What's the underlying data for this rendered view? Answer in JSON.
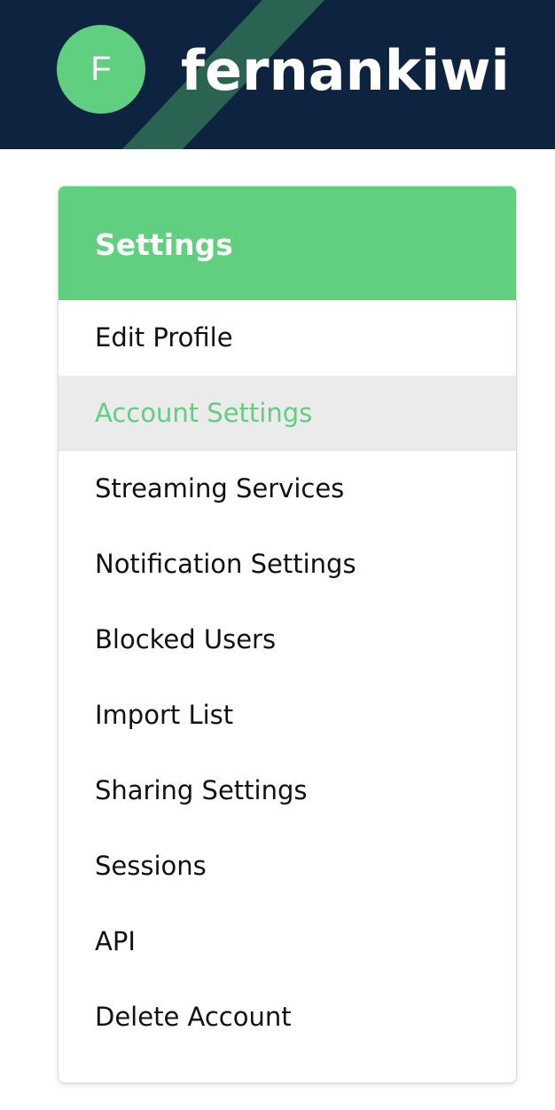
{
  "user": {
    "avatar_letter": "F",
    "username": "fernankiwi"
  },
  "colors": {
    "header_bg": "#0e2340",
    "accent": "#60cf80",
    "active_bg": "#ebebeb"
  },
  "settings": {
    "title": "Settings",
    "active_item": "Account Settings",
    "items": [
      {
        "label": "Edit Profile"
      },
      {
        "label": "Account Settings"
      },
      {
        "label": "Streaming Services"
      },
      {
        "label": "Notification Settings"
      },
      {
        "label": "Blocked Users"
      },
      {
        "label": "Import List"
      },
      {
        "label": "Sharing Settings"
      },
      {
        "label": "Sessions"
      },
      {
        "label": "API"
      },
      {
        "label": "Delete Account"
      }
    ]
  }
}
